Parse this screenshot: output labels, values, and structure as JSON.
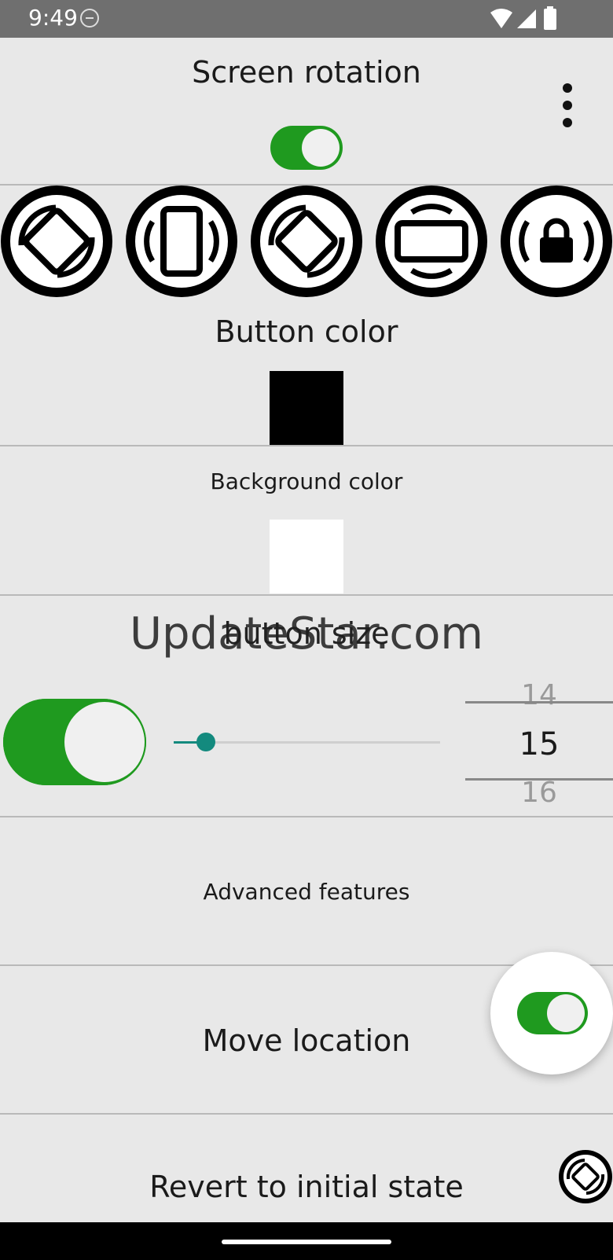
{
  "status_bar": {
    "time": "9:49"
  },
  "screen_rotation": {
    "title": "Screen rotation",
    "enabled": true
  },
  "rotation_modes": [
    {
      "icon": "auto-rotate-icon"
    },
    {
      "icon": "portrait-icon"
    },
    {
      "icon": "landscape-tilt-icon"
    },
    {
      "icon": "landscape-icon"
    },
    {
      "icon": "rotation-lock-icon"
    }
  ],
  "button_color": {
    "title": "Button color",
    "swatch": "#000000"
  },
  "background_color": {
    "title": "Background color",
    "swatch": "#ffffff"
  },
  "button_size": {
    "title": "button size",
    "watermark": "UpdateStar.com",
    "enabled": true,
    "slider_fraction": 0.12,
    "picker": {
      "prev": "14",
      "current": "15",
      "next": "16"
    }
  },
  "advanced_features": {
    "title": "Advanced features"
  },
  "move_location": {
    "title": "Move location",
    "enabled": true
  },
  "revert": {
    "title": "Revert to initial state"
  },
  "colors": {
    "accent": "#1f9a1f",
    "slider": "#138a7e",
    "background": "#e8e8e8"
  }
}
